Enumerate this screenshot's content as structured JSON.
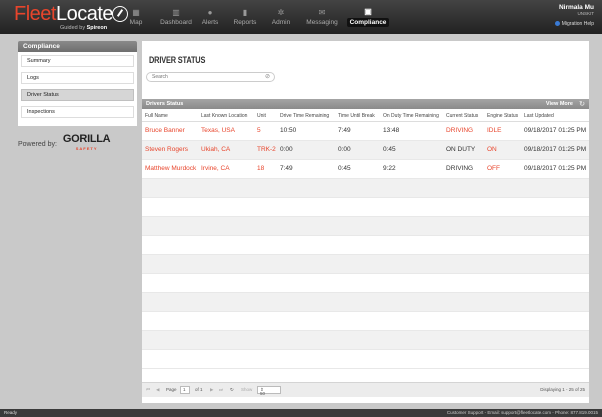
{
  "brand": {
    "logo_fleet": "Fleet",
    "logo_locate": "Locate",
    "tagline_prefix": "Guided by",
    "tagline_brand": "Spireon"
  },
  "nav": [
    {
      "label": "Map",
      "icon": "map-icon",
      "glyph": "▦"
    },
    {
      "label": "Dashboard",
      "icon": "dashboard-icon",
      "glyph": "▥"
    },
    {
      "label": "Alerts",
      "icon": "alerts-icon",
      "glyph": "●"
    },
    {
      "label": "Reports",
      "icon": "reports-icon",
      "glyph": "▮"
    },
    {
      "label": "Admin",
      "icon": "admin-icon",
      "glyph": "✲"
    },
    {
      "label": "Messaging",
      "icon": "messaging-icon",
      "glyph": "✉"
    },
    {
      "label": "Compliance",
      "icon": "compliance-icon",
      "glyph": "▣"
    }
  ],
  "user": {
    "name": "Nirmala Mu",
    "account": "UNSKIT",
    "help": "Migration Help"
  },
  "sidebar": {
    "title": "Compliance",
    "items": [
      {
        "label": "Summary"
      },
      {
        "label": "Logs"
      },
      {
        "label": "Driver Status"
      },
      {
        "label": "Inspections"
      }
    ],
    "powered_by": "Powered by:",
    "partner": "GORILLA",
    "partner_sub": "SAFETY"
  },
  "main": {
    "title": "DRIVER STATUS",
    "search_placeholder": "Search",
    "grid_title": "Drivers Status",
    "view_more": "View More",
    "columns": [
      "Full Name",
      "Last Known Location",
      "Unit",
      "Drive Time Remaining",
      "Time Until Break",
      "On Duty Time Remaining",
      "Current Status",
      "Engine Status",
      "Last Updated"
    ],
    "rows": [
      {
        "name": "Bruce Banner",
        "location": "Texas, USA",
        "unit": "5",
        "drive": "10:50",
        "break": "7:49",
        "onduty": "13:48",
        "status": "DRIVING",
        "engine": "IDLE",
        "updated": "09/18/2017 01:25 PM"
      },
      {
        "name": "Steven Rogers",
        "location": "Ukiah, CA",
        "unit": "TRK-2",
        "drive": "0:00",
        "break": "0:00",
        "onduty": "0:45",
        "status": "ON DUTY",
        "engine": "ON",
        "updated": "09/18/2017 01:25 PM"
      },
      {
        "name": "Matthew Murdock",
        "location": "Irvine, CA",
        "unit": "18",
        "drive": "7:49",
        "break": "0:45",
        "onduty": "9:22",
        "status": "DRIVING",
        "engine": "OFF",
        "updated": "09/18/2017 01:25 PM"
      }
    ],
    "pager": {
      "page_label": "Page",
      "page": "1",
      "of": "of 1",
      "show_label": "Show",
      "show_value": "50",
      "displaying": "Displaying 1 - 25 of 25"
    }
  },
  "statusbar": {
    "ready": "Ready",
    "support": "Customer Support - Email: support@fleetlocate.com - Phone: 877.819.0015"
  },
  "colors": {
    "accent": "#e8452c",
    "topbar": "#2a2a2a",
    "background": "#c9c9c9"
  }
}
